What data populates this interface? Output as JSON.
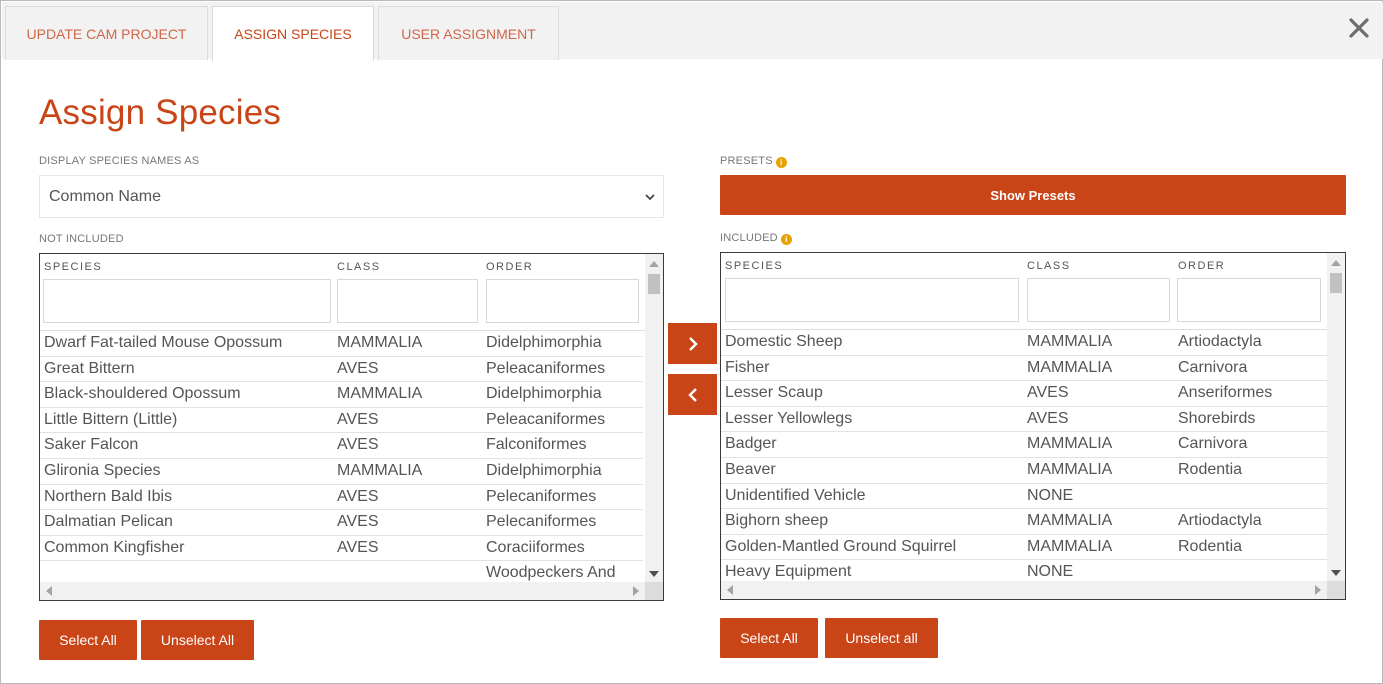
{
  "tabs": [
    {
      "label": "UPDATE CAM PROJECT"
    },
    {
      "label": "ASSIGN SPECIES"
    },
    {
      "label": "USER ASSIGNMENT"
    }
  ],
  "page_title": "Assign Species",
  "display_names": {
    "label": "DISPLAY SPECIES NAMES AS",
    "selected": "Common Name"
  },
  "presets": {
    "label": "PRESETS",
    "button": "Show Presets"
  },
  "not_included": {
    "label": "NOT INCLUDED",
    "columns": [
      "SPECIES",
      "CLASS",
      "ORDER"
    ],
    "rows": [
      [
        "Dwarf Fat-tailed Mouse Opossum",
        "MAMMALIA",
        "Didelphimorphia"
      ],
      [
        "Great Bittern",
        "AVES",
        "Peleacaniformes"
      ],
      [
        "Black-shouldered Opossum",
        "MAMMALIA",
        "Didelphimorphia"
      ],
      [
        "Little Bittern (Little)",
        "AVES",
        "Peleacaniformes"
      ],
      [
        "Saker Falcon",
        "AVES",
        "Falconiformes"
      ],
      [
        "Glironia Species",
        "MAMMALIA",
        "Didelphimorphia"
      ],
      [
        "Northern Bald Ibis",
        "AVES",
        "Pelecaniformes"
      ],
      [
        "Dalmatian Pelican",
        "AVES",
        "Pelecaniformes"
      ],
      [
        "Common Kingfisher",
        "AVES",
        "Coraciiformes"
      ],
      [
        "",
        "",
        "Woodpeckers And"
      ]
    ],
    "select_all": "Select All",
    "unselect_all": "Unselect All"
  },
  "included": {
    "label": "INCLUDED",
    "columns": [
      "SPECIES",
      "CLASS",
      "ORDER"
    ],
    "rows": [
      [
        "Domestic Sheep",
        "MAMMALIA",
        "Artiodactyla"
      ],
      [
        "Fisher",
        "MAMMALIA",
        "Carnivora"
      ],
      [
        "Lesser Scaup",
        "AVES",
        "Anseriformes"
      ],
      [
        "Lesser Yellowlegs",
        "AVES",
        "Shorebirds"
      ],
      [
        "Badger",
        "MAMMALIA",
        "Carnivora"
      ],
      [
        "Beaver",
        "MAMMALIA",
        "Rodentia"
      ],
      [
        "Unidentified Vehicle",
        "NONE",
        ""
      ],
      [
        "Bighorn sheep",
        "MAMMALIA",
        "Artiodactyla"
      ],
      [
        "Golden-Mantled Ground Squirrel",
        "MAMMALIA",
        "Rodentia"
      ],
      [
        "Heavy Equipment",
        "NONE",
        ""
      ]
    ],
    "select_all": "Select All",
    "unselect_all": "Unselect all"
  },
  "colors": {
    "accent": "#c94416",
    "tab_text": "#d1664a",
    "info": "#e8a200"
  }
}
